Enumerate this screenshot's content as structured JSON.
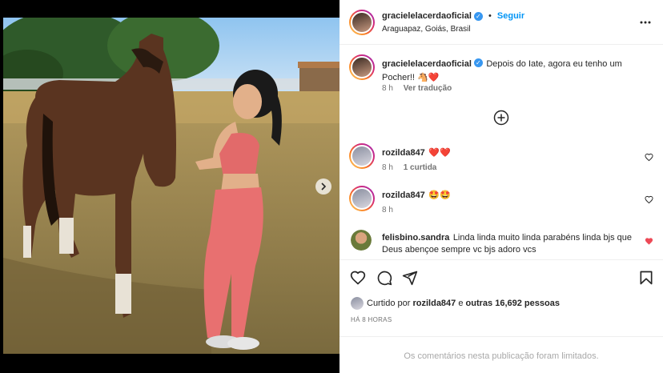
{
  "header": {
    "username": "gracielelacerdaoficial",
    "separator": "•",
    "follow_label": "Seguir",
    "location": "Araguapaz, Goiás, Brasil",
    "more_icon": "more-horizontal-icon"
  },
  "caption": {
    "username": "gracielelacerdaoficial",
    "text": "Depois do Iate, agora eu tenho um Pocher!! 🐴❤️",
    "time": "8 h",
    "translate": "Ver tradução"
  },
  "load_more_icon": "plus-circle-icon",
  "comments": [
    {
      "username": "rozilda847",
      "text": "❤️❤️",
      "time": "8 h",
      "likes": "1 curtida"
    },
    {
      "username": "rozilda847",
      "text": "🤩🤩",
      "time": "8 h",
      "likes": ""
    },
    {
      "username": "felisbino.sandra",
      "text": "Linda linda muito linda parabéns linda bjs que Deus abençoe sempre vc bjs adoro vcs",
      "time": "",
      "likes": ""
    }
  ],
  "actions": {
    "like_icon": "heart-icon",
    "comment_icon": "comment-icon",
    "share_icon": "send-icon",
    "save_icon": "bookmark-icon"
  },
  "likes": {
    "prefix": "Curtido por",
    "user": "rozilda847",
    "connector": "e",
    "others": "outras 16,692 pessoas"
  },
  "timestamp": "HÁ 8 HORAS",
  "footer_note": "Os comentários nesta publicação foram limitados.",
  "colors": {
    "accent": "#0095f6",
    "heart_red": "#ed4956",
    "verified": "#3897f0"
  }
}
